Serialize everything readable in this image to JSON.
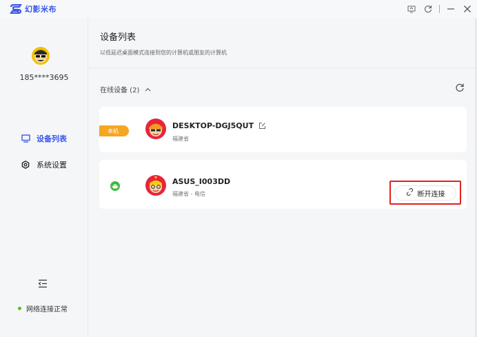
{
  "app": {
    "name": "幻影米布",
    "brand_color": "#3a57e8"
  },
  "window_controls": {
    "icons": [
      "screenshot-icon",
      "refresh-icon",
      "minimize-icon",
      "close-icon"
    ]
  },
  "sidebar": {
    "phone": "185****3695",
    "nav": [
      {
        "label": "设备列表",
        "icon": "monitor-icon",
        "active": true
      },
      {
        "label": "系统设置",
        "icon": "gear-icon",
        "active": false
      }
    ],
    "network_status": "网络连接正常",
    "status_color": "#52c41a"
  },
  "main": {
    "title": "设备列表",
    "subtitle": "以低延迟桌面模式连接到您的计算机或朋友的计算机",
    "online_header": "在线设备 (2)",
    "devices": [
      {
        "tag": "本机",
        "name": "DESKTOP-DGJ5QUT",
        "location": "福建省"
      },
      {
        "name": "ASUS_I003DD",
        "location": "福建省 - 电信",
        "action": "断开连接",
        "platform_icon": "android-icon"
      }
    ]
  }
}
